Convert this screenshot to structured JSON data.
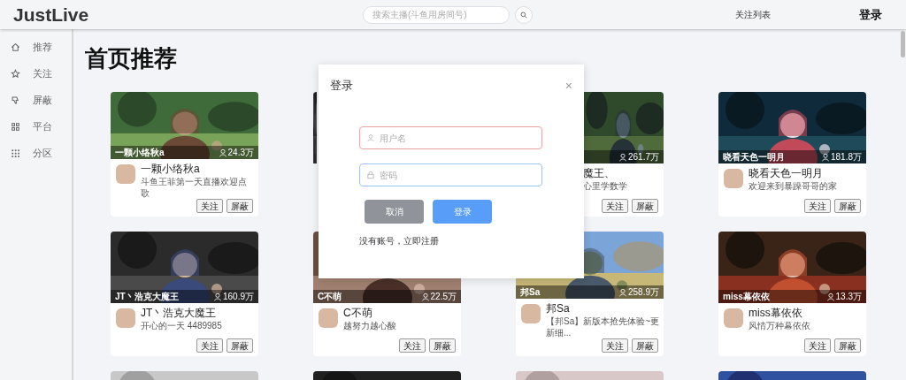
{
  "header": {
    "logo": "JustLive",
    "search": {
      "placeholder": "搜索主播(斗鱼用房间号)"
    },
    "follow_list": "关注列表",
    "login": "登录"
  },
  "sidebar": {
    "items": [
      {
        "label": "推荐"
      },
      {
        "label": "关注"
      },
      {
        "label": "屏蔽"
      },
      {
        "label": "平台"
      },
      {
        "label": "分区"
      }
    ]
  },
  "page_title": "首页推荐",
  "cards": [
    {
      "kind": "stream",
      "title_overlay": "一颗小络秋a",
      "viewers": "24.3万",
      "name": "一颗小络秋a",
      "description": "斗鱼王菲第一天直播欢迎点歌",
      "follow": "关注",
      "block": "屏蔽"
    },
    {
      "kind": "covered"
    },
    {
      "kind": "partial",
      "viewers": "261.7万",
      "name": "魔王、",
      "description": "心里学数学",
      "follow": "关注",
      "block": "屏蔽"
    },
    {
      "kind": "stream",
      "title_overlay": "晓看天色一明月",
      "viewers": "181.8万",
      "name": "晓看天色一明月",
      "description": "欢迎来到暴躁哥哥的家",
      "follow": "关注",
      "block": "屏蔽"
    },
    {
      "kind": "stream",
      "title_overlay": "JT丶浩克大魔王",
      "viewers": "160.9万",
      "name": "JT丶浩克大魔王",
      "description": "开心的一天 4489985",
      "follow": "关注",
      "block": "屏蔽"
    },
    {
      "kind": "stream",
      "title_overlay": "C不萌",
      "viewers": "22.5万",
      "name": "C不萌",
      "description": "越努力越心酸",
      "follow": "关注",
      "block": "屏蔽"
    },
    {
      "kind": "stream",
      "title_overlay": "邦Sa",
      "viewers": "258.9万",
      "name": "邦Sa",
      "description": "【邦Sa】新版本抢先体验~更新细...",
      "follow": "关注",
      "block": "屏蔽"
    },
    {
      "kind": "stream",
      "title_overlay": "miss幕依依",
      "viewers": "13.3万",
      "name": "miss幕依依",
      "description": "风情万种幕依依",
      "follow": "关注",
      "block": "屏蔽"
    },
    {
      "kind": "cut"
    },
    {
      "kind": "cut"
    },
    {
      "kind": "cut"
    },
    {
      "kind": "cut"
    }
  ],
  "login_dialog": {
    "title": "登录",
    "close": "×",
    "fields": [
      {
        "placeholder": "用户名",
        "error": true
      },
      {
        "placeholder": "密码",
        "error": false,
        "focused": true
      }
    ],
    "cancel": "取消",
    "submit": "登录",
    "register_link": "没有账号，立即注册"
  }
}
